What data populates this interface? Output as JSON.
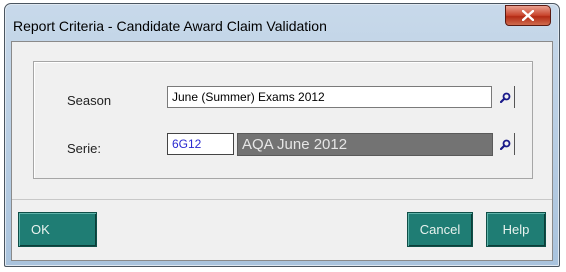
{
  "window": {
    "title": "Report Criteria - Candidate Award Claim Validation",
    "close_icon": "close-x-icon"
  },
  "criteria": {
    "season": {
      "label": "Season",
      "value": "June (Summer) Exams 2012",
      "lookup_icon": "magnifier-icon"
    },
    "series": {
      "label": "Serie:",
      "code": "6G12",
      "description": "AQA June 2012",
      "lookup_icon": "magnifier-icon"
    }
  },
  "buttons": {
    "ok": "OK",
    "cancel": "Cancel",
    "help": "Help"
  },
  "colors": {
    "button_bg": "#1f7d74",
    "close_button": "#c8442c",
    "series_description_bg": "#737373"
  }
}
